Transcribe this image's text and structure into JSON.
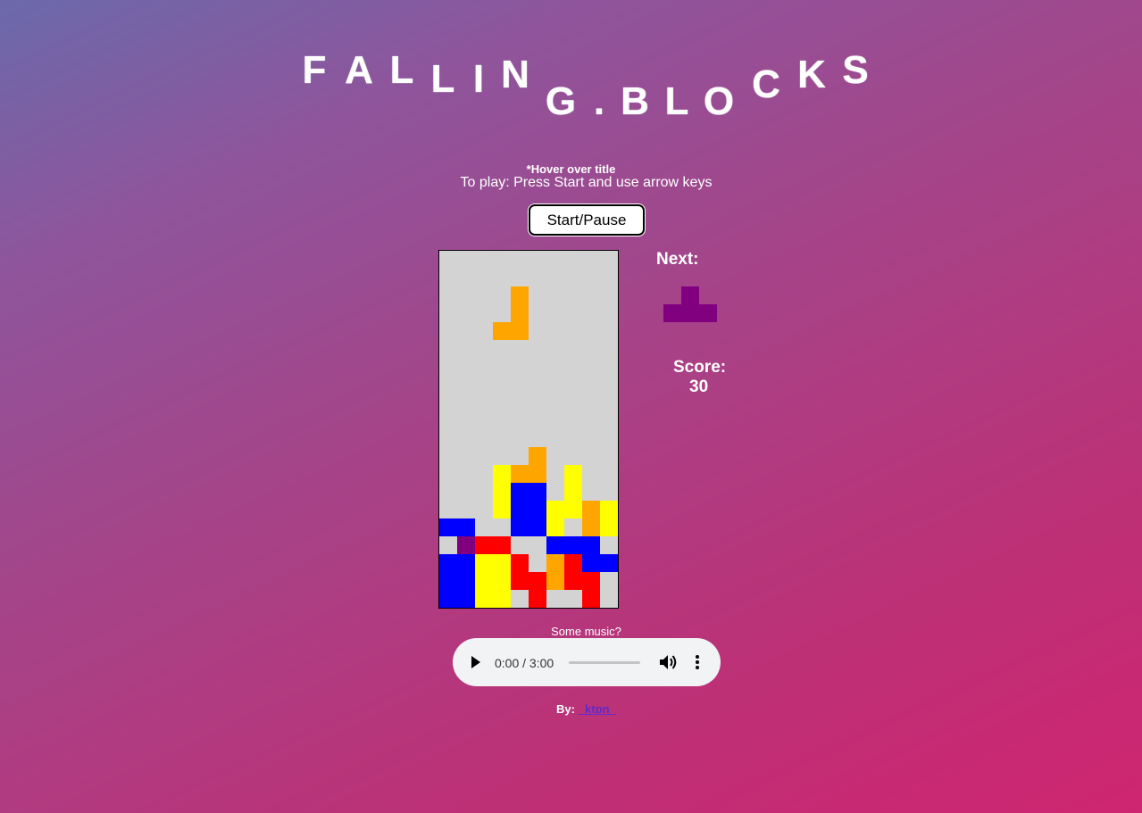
{
  "title": {
    "letters": [
      "F",
      "A",
      "L",
      "L",
      "I",
      "N",
      "G",
      ".",
      "B",
      "L",
      "O",
      "C",
      "K",
      "S"
    ]
  },
  "hint": "*Hover over title",
  "instructions": "To play: Press Start and use arrow keys",
  "start_button_label": "Start/Pause",
  "board": {
    "rows": 20,
    "cols": 10,
    "background": "#d3d3d3",
    "cells": [
      [
        2,
        4,
        "O"
      ],
      [
        3,
        4,
        "O"
      ],
      [
        4,
        3,
        "O"
      ],
      [
        4,
        4,
        "O"
      ],
      [
        11,
        5,
        "O"
      ],
      [
        12,
        5,
        "O"
      ],
      [
        12,
        4,
        "O"
      ],
      [
        13,
        4,
        "B"
      ],
      [
        13,
        5,
        "B"
      ],
      [
        12,
        3,
        "Y"
      ],
      [
        13,
        3,
        "Y"
      ],
      [
        14,
        3,
        "Y"
      ],
      [
        12,
        7,
        "Y"
      ],
      [
        13,
        7,
        "Y"
      ],
      [
        14,
        7,
        "Y"
      ],
      [
        14,
        6,
        "Y"
      ],
      [
        15,
        6,
        "Y"
      ],
      [
        14,
        8,
        "O"
      ],
      [
        15,
        8,
        "O"
      ],
      [
        14,
        9,
        "Y"
      ],
      [
        15,
        9,
        "Y"
      ],
      [
        15,
        0,
        "B"
      ],
      [
        15,
        1,
        "B"
      ],
      [
        14,
        4,
        "B"
      ],
      [
        14,
        5,
        "B"
      ],
      [
        15,
        4,
        "B"
      ],
      [
        15,
        5,
        "B"
      ],
      [
        16,
        1,
        "P"
      ],
      [
        16,
        2,
        "R"
      ],
      [
        16,
        3,
        "R"
      ],
      [
        16,
        6,
        "B"
      ],
      [
        16,
        7,
        "B"
      ],
      [
        16,
        8,
        "B"
      ],
      [
        17,
        8,
        "B"
      ],
      [
        17,
        9,
        "B"
      ],
      [
        17,
        0,
        "B"
      ],
      [
        17,
        1,
        "B"
      ],
      [
        18,
        0,
        "B"
      ],
      [
        18,
        1,
        "B"
      ],
      [
        19,
        0,
        "B"
      ],
      [
        19,
        1,
        "B"
      ],
      [
        17,
        2,
        "Y"
      ],
      [
        17,
        3,
        "Y"
      ],
      [
        18,
        2,
        "Y"
      ],
      [
        18,
        3,
        "Y"
      ],
      [
        19,
        2,
        "Y"
      ],
      [
        19,
        3,
        "Y"
      ],
      [
        17,
        4,
        "R"
      ],
      [
        18,
        4,
        "R"
      ],
      [
        18,
        5,
        "R"
      ],
      [
        19,
        5,
        "R"
      ],
      [
        17,
        6,
        "O"
      ],
      [
        18,
        6,
        "O"
      ],
      [
        17,
        7,
        "R"
      ],
      [
        18,
        7,
        "R"
      ],
      [
        18,
        8,
        "R"
      ],
      [
        19,
        8,
        "R"
      ]
    ]
  },
  "colors": {
    "O": "#ffa500",
    "Y": "#ffff00",
    "B": "#0000ff",
    "R": "#ff0000",
    "P": "#800080"
  },
  "next": {
    "label": "Next:",
    "color": "#800080",
    "cells": [
      [
        0,
        1
      ],
      [
        1,
        0
      ],
      [
        1,
        1
      ],
      [
        1,
        2
      ]
    ]
  },
  "score": {
    "label": "Score:",
    "value": "30"
  },
  "music": {
    "label": "Some music?",
    "time": "0:00 / 3:00"
  },
  "byline": {
    "label": "By:",
    "author": "_ktpn_"
  },
  "icons": [
    "play-icon",
    "volume-icon",
    "more-options-icon"
  ]
}
